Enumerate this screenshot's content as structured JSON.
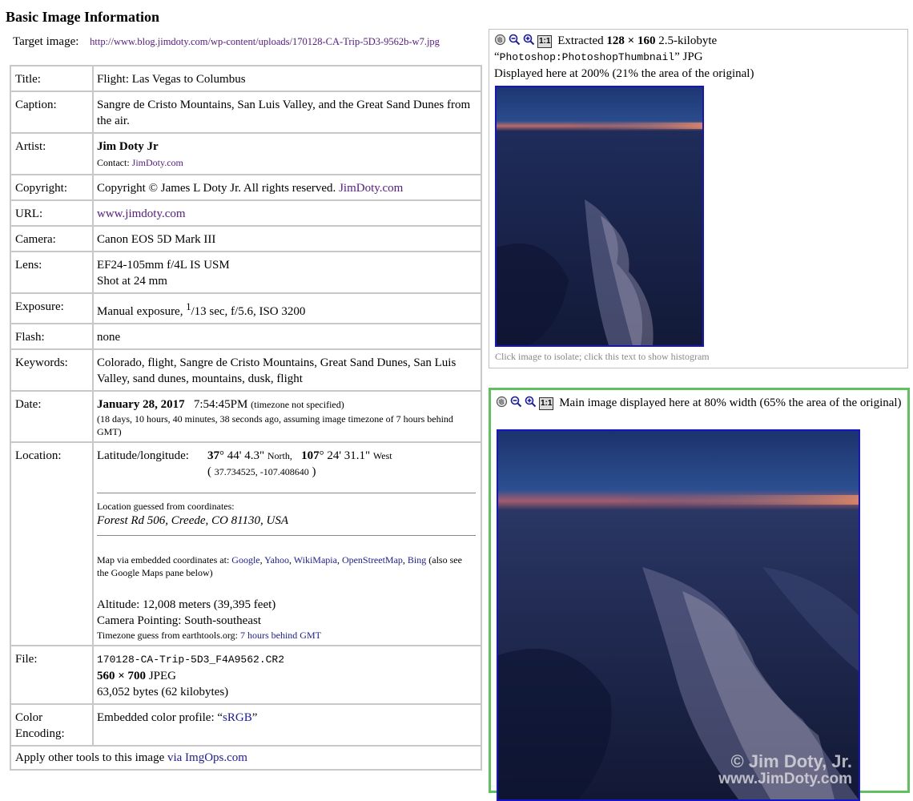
{
  "page": {
    "heading": "Basic Image Information",
    "target_label": "Target image:",
    "target_url": "http://www.blog.jimdoty.com/wp-content/uploads/170128-CA-Trip-5D3-9562b-w7.jpg"
  },
  "info": {
    "title_label": "Title:",
    "title_value": "Flight: Las Vegas to Columbus",
    "caption_label": "Caption:",
    "caption_value": "Sangre de Cristo Mountains, San Luis Valley, and the Great Sand Dunes from the air.",
    "artist_label": "Artist:",
    "artist_name": "Jim Doty Jr",
    "artist_contact_label": "Contact:",
    "artist_contact_link": "JimDoty.com",
    "copyright_label": "Copyright:",
    "copyright_text": "Copyright © James L Doty Jr. All rights reserved.",
    "copyright_link": "JimDoty.com",
    "url_label": "URL:",
    "url_value": "www.jimdoty.com",
    "camera_label": "Camera:",
    "camera_value": "Canon EOS 5D Mark III",
    "lens_label": "Lens:",
    "lens_value": "EF24-105mm f/4L IS USM",
    "lens_shot": "Shot at 24 mm",
    "exposure_label": "Exposure:",
    "exposure_prefix": "Manual exposure,",
    "exposure_num": "1",
    "exposure_rest": "/13 sec, f/5.6, ISO 3200",
    "flash_label": "Flash:",
    "flash_value": "none",
    "keywords_label": "Keywords:",
    "keywords_value": "Colorado, flight, Sangre de Cristo Mountains, Great Sand Dunes, San Luis Valley, sand dunes, mountains, dusk, flight",
    "date_label": "Date:",
    "date_main": "January 28, 2017",
    "date_time": "7:54:45PM",
    "date_tz": "(timezone not specified)",
    "date_ago": "(18 days, 10 hours, 40 minutes, 38 seconds ago, assuming image timezone of 7 hours behind GMT)",
    "location_label": "Location:",
    "latlong_label": "Latitude/longitude:",
    "lat_deg": "37",
    "lat_rest": "° 44' 4.3\"",
    "lat_dir": "North,",
    "long_deg": "107",
    "long_rest": "° 24' 31.1\"",
    "long_dir": "West",
    "decimal_coords": "37.734525, -107.408640",
    "guessed_label": "Location guessed from coordinates:",
    "guessed_address": "Forest Rd 506, Creede, CO 81130, USA",
    "map_prefix": "Map via embedded coordinates at:",
    "map_links": [
      "Google",
      "Yahoo",
      "WikiMapia",
      "OpenStreetMap",
      "Bing"
    ],
    "map_suffix": "(also see the Google Maps pane below)",
    "altitude": "Altitude: 12,008 meters (39,395 feet)",
    "pointing": "Camera Pointing: South-southeast",
    "tz_guess_prefix": "Timezone guess from earthtools.org:",
    "tz_guess_link": "7 hours behind GMT",
    "file_label": "File:",
    "file_name": "170128-CA-Trip-5D3_F4A9562.CR2",
    "file_dims": "560 × 700",
    "file_type": "JPEG",
    "file_bytes": "63,052 bytes (62 kilobytes)",
    "color_label_1": "Color",
    "color_label_2": "Encoding:",
    "color_prefix": "Embedded color profile:",
    "color_profile": "sRGB",
    "apply_prefix": "Apply other tools to this image",
    "apply_link": "via ImgOps.com"
  },
  "thumb_pane": {
    "extracted": "Extracted",
    "dims": "128 × 160",
    "size": "2.5-kilobyte",
    "source": "Photoshop:PhotoshopThumbnail",
    "format": "JPG",
    "displayed": "Displayed here at 200% (21% the area of the original)",
    "caption": "Click image to isolate; click this text to show histogram"
  },
  "main_pane": {
    "text": "Main image displayed here at 80% width (65% the area of the original)",
    "watermark_1": "© Jim Doty, Jr.",
    "watermark_2": "www.JimDoty.com"
  },
  "tools": {
    "one_to_one": "1:1"
  },
  "colors": {
    "pane_border": "#5ec05e",
    "photo_border": "#1515c8"
  }
}
